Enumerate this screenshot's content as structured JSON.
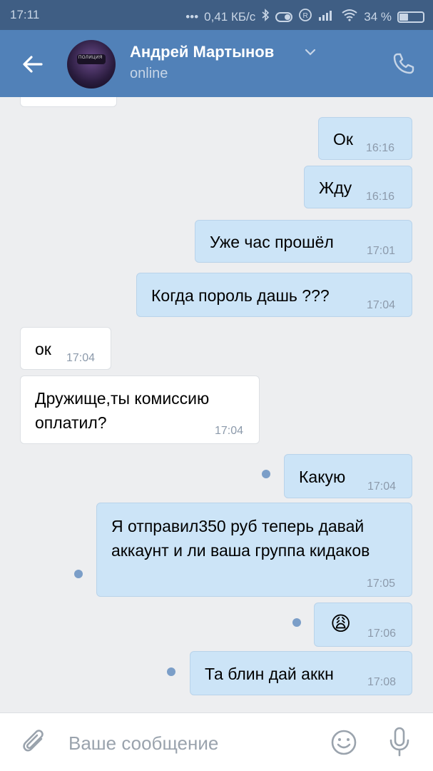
{
  "status_bar": {
    "time": "17:11",
    "speed": "0,41 КБ/с",
    "battery": "34 %"
  },
  "header": {
    "contact_name": "Андрей Мартынов",
    "status": "online",
    "avatar_text": "ПОЛИЦИЯ"
  },
  "messages": [
    {
      "dir": "out",
      "text": "Ок",
      "time": "16:16"
    },
    {
      "dir": "out",
      "text": "Жду",
      "time": "16:16"
    },
    {
      "dir": "out",
      "text": "Уже час прошёл",
      "time": "17:01"
    },
    {
      "dir": "out",
      "text": "Когда пороль дашь ???",
      "time": "17:04"
    },
    {
      "dir": "in",
      "text": "ок",
      "time": "17:04"
    },
    {
      "dir": "in",
      "text": "Дружище,ты комиссию оплатил?",
      "time": "17:04"
    },
    {
      "dir": "out",
      "text": "Какую",
      "time": "17:04",
      "unread": true
    },
    {
      "dir": "out",
      "text": "Я отправил350 руб теперь давай аккаунт и ли ваша группа кидаков",
      "time": "17:05",
      "unread": true
    },
    {
      "dir": "out",
      "text": "😩",
      "time": "17:06",
      "unread": true
    },
    {
      "dir": "out",
      "text": "Та блин дай аккн",
      "time": "17:08",
      "unread": true
    }
  ],
  "composer": {
    "placeholder": "Ваше сообщение"
  },
  "colors": {
    "header_bg": "#5181b8",
    "status_bg": "#3f5e84",
    "chat_bg": "#edeef0",
    "outgoing_bubble": "#cce4f7",
    "incoming_bubble": "#ffffff"
  }
}
